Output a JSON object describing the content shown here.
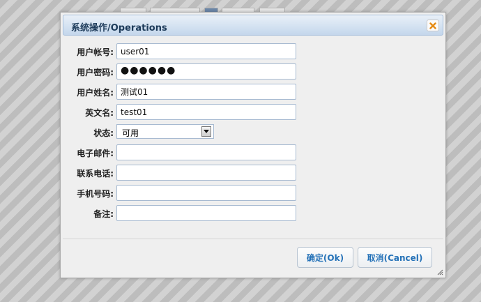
{
  "dialog": {
    "title": "系统操作/Operations",
    "close_icon": "close-icon"
  },
  "form": {
    "account": {
      "label": "用户帐号:",
      "value": "user01"
    },
    "password": {
      "label": "用户密码:",
      "value": "●●●●●●"
    },
    "name": {
      "label": "用户姓名:",
      "value": "测试01"
    },
    "english_name": {
      "label": "英文名:",
      "value": "test01"
    },
    "status": {
      "label": "状态:",
      "value": "可用"
    },
    "email": {
      "label": "电子邮件:",
      "value": ""
    },
    "phone": {
      "label": "联系电话:",
      "value": ""
    },
    "mobile": {
      "label": "手机号码:",
      "value": ""
    },
    "remark": {
      "label": "备注:",
      "value": ""
    }
  },
  "buttons": {
    "ok": "确定(Ok)",
    "cancel": "取消(Cancel)"
  },
  "colors": {
    "title_text": "#1d3b5a",
    "button_text": "#2572b8",
    "close_icon": "#e58a12"
  }
}
